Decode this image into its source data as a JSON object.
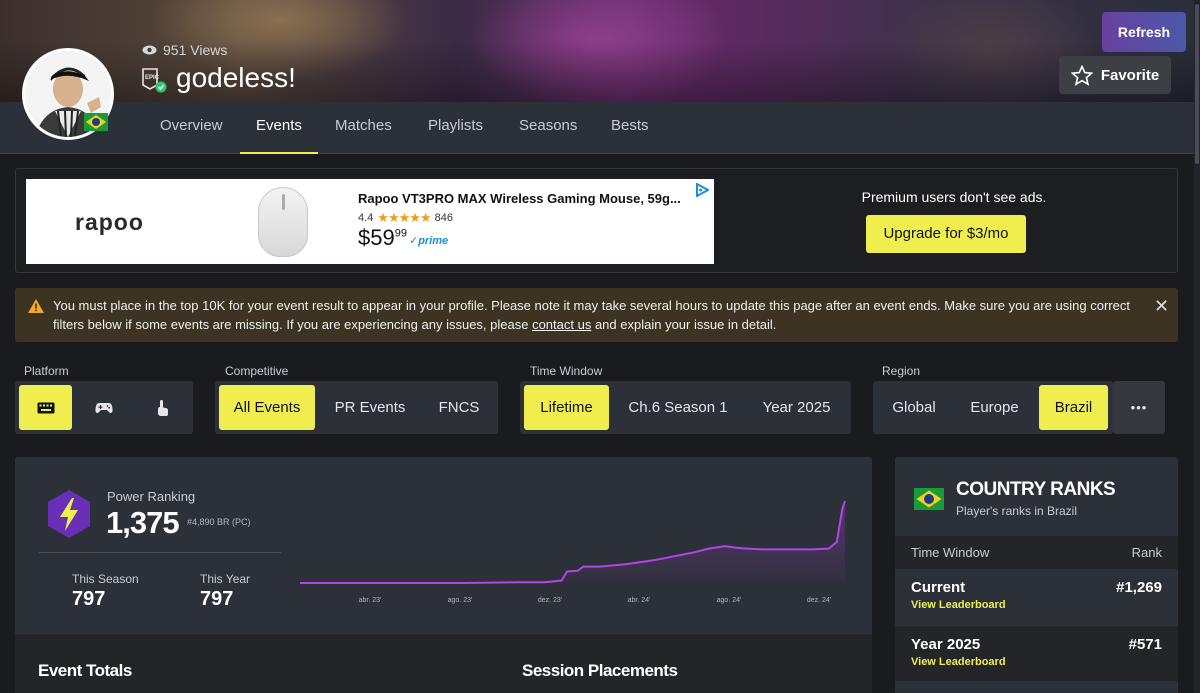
{
  "profile": {
    "views": "951 Views",
    "username": "godeless!",
    "country_flag": "brazil-flag",
    "platform_badge": "epic-games-icon"
  },
  "header_buttons": {
    "refresh": "Refresh",
    "favorite": "Favorite"
  },
  "nav": {
    "tabs": [
      {
        "label": "Overview"
      },
      {
        "label": "Events",
        "active": true
      },
      {
        "label": "Matches"
      },
      {
        "label": "Playlists"
      },
      {
        "label": "Seasons"
      },
      {
        "label": "Bests"
      }
    ]
  },
  "ad": {
    "brand": "rapoo",
    "product_title": "Rapoo VT3PRO MAX Wireless Gaming Mouse, 59g...",
    "rating": "4.4",
    "stars": "★★★★★",
    "reviews": "846",
    "price_main": "$59",
    "price_cents": "99",
    "prime": "✓prime",
    "premium_text": "Premium users don't see ads.",
    "upgrade_label": "Upgrade for $3/mo"
  },
  "warning": {
    "text_before": "You must place in the top 10K for your event result to appear in your profile. Please note it may take several hours to update this page after an event ends. Make sure you are using correct filters below if some events are missing. If you are experiencing any issues, please ",
    "link": "contact us",
    "text_after": " and explain your issue in detail.",
    "close": "✕"
  },
  "filters": {
    "platform": {
      "label": "Platform",
      "options": [
        "keyboard-icon",
        "gamepad-icon",
        "touch-icon"
      ],
      "selected": 0
    },
    "competitive": {
      "label": "Competitive",
      "options": [
        "All Events",
        "PR Events",
        "FNCS"
      ],
      "selected": 0
    },
    "time_window": {
      "label": "Time Window",
      "options": [
        "Lifetime",
        "Ch.6 Season 1",
        "Year 2025"
      ],
      "selected": 0
    },
    "region": {
      "label": "Region",
      "options": [
        "Global",
        "Europe",
        "Brazil"
      ],
      "selected": 2,
      "more": "•••"
    }
  },
  "power_ranking": {
    "label": "Power Ranking",
    "value": "1,375",
    "sub": "#4,890 BR (PC)",
    "this_season_label": "This Season",
    "this_season_value": "797",
    "this_year_label": "This Year",
    "this_year_value": "797"
  },
  "chart_data": {
    "type": "area",
    "title": "",
    "xlabel": "",
    "ylabel": "",
    "x_ticks": [
      "abr. 23'",
      "ago. 23'",
      "dez. 23'",
      "abr. 24'",
      "ago. 24'",
      "dez. 24'"
    ],
    "series": [
      {
        "values": [
          [
            0,
            0
          ],
          [
            0.05,
            0
          ],
          [
            0.1,
            0
          ],
          [
            0.2,
            0
          ],
          [
            0.3,
            0
          ],
          [
            0.4,
            0.01
          ],
          [
            0.45,
            0.01
          ],
          [
            0.48,
            0.03
          ],
          [
            0.49,
            0.14
          ],
          [
            0.51,
            0.15
          ],
          [
            0.52,
            0.2
          ],
          [
            0.55,
            0.2
          ],
          [
            0.6,
            0.23
          ],
          [
            0.63,
            0.26
          ],
          [
            0.66,
            0.29
          ],
          [
            0.69,
            0.33
          ],
          [
            0.72,
            0.37
          ],
          [
            0.75,
            0.42
          ],
          [
            0.78,
            0.45
          ],
          [
            0.8,
            0.43
          ],
          [
            0.82,
            0.42
          ],
          [
            0.85,
            0.41
          ],
          [
            0.9,
            0.41
          ],
          [
            0.94,
            0.41
          ],
          [
            0.97,
            0.42
          ],
          [
            0.985,
            0.5
          ],
          [
            0.995,
            0.9
          ],
          [
            1.0,
            1.0
          ]
        ]
      }
    ],
    "color": "#b543e6"
  },
  "sections": {
    "event_totals": "Event Totals",
    "session_placements": "Session Placements"
  },
  "country_ranks": {
    "title": "COUNTRY RANKS",
    "subtitle": "Player's ranks in Brazil",
    "col_time": "Time Window",
    "col_rank": "Rank",
    "rows": [
      {
        "name": "Current",
        "link": "View Leaderboard",
        "rank": "#1,269"
      },
      {
        "name": "Year 2025",
        "link": "View Leaderboard",
        "rank": "#571"
      }
    ]
  },
  "colors": {
    "accent": "#f0ee4f",
    "chart_line": "#b543e6",
    "panel": "#2c3038",
    "background": "#1a1b1f"
  }
}
